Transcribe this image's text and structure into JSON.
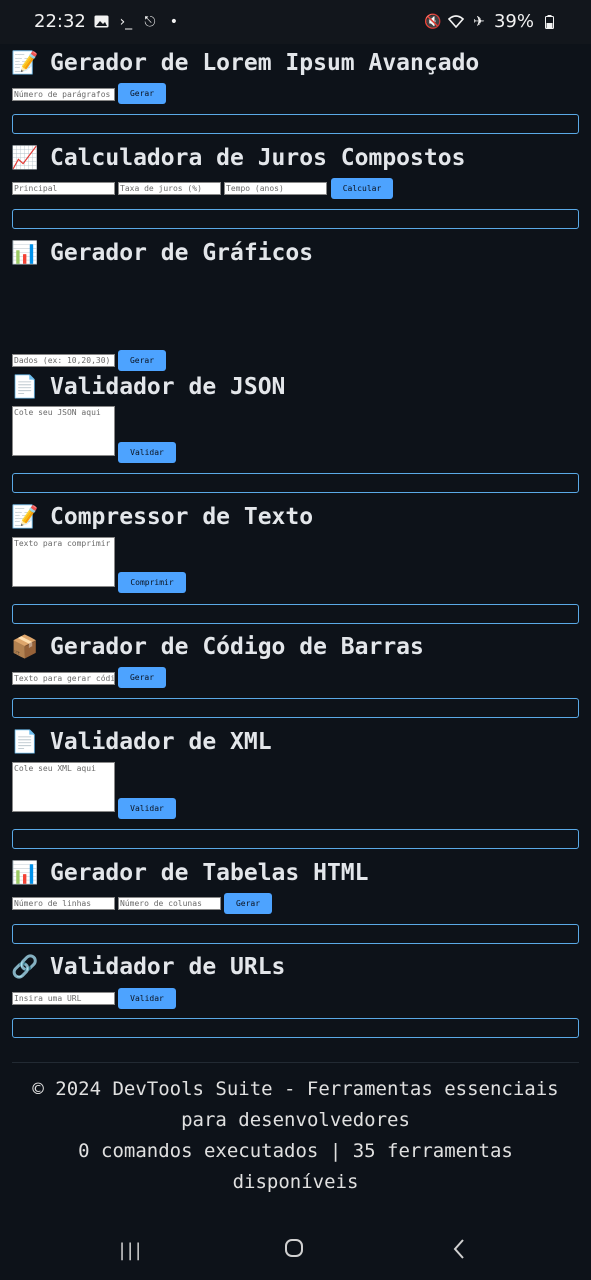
{
  "statusbar": {
    "time": "22:32",
    "battery": "39%",
    "icons_left": [
      "image-icon",
      "terminal-icon",
      "share-icon",
      "dot-icon"
    ],
    "icons_right": [
      "mute-icon",
      "wifi-icon",
      "airplane-icon",
      "battery-icon"
    ]
  },
  "sections": {
    "lorem": {
      "emoji": "📝",
      "title": "Gerador de Lorem Ipsum Avançado",
      "input_placeholder": "Número de parágrafos",
      "button": "Gerar"
    },
    "juros": {
      "emoji": "📈",
      "title": "Calculadora de Juros Compostos",
      "principal_placeholder": "Principal",
      "taxa_placeholder": "Taxa de juros (%)",
      "tempo_placeholder": "Tempo (anos)",
      "button": "Calcular"
    },
    "graficos": {
      "emoji": "📊",
      "title": "Gerador de Gráficos",
      "input_placeholder": "Dados (ex: 10,20,30)",
      "button": "Gerar"
    },
    "json": {
      "emoji": "📄",
      "title": "Validador de JSON",
      "textarea_placeholder": "Cole seu JSON aqui",
      "button": "Validar"
    },
    "compressor": {
      "emoji": "📝",
      "title": "Compressor de Texto",
      "textarea_placeholder": "Texto para comprimir",
      "button": "Comprimir"
    },
    "barras": {
      "emoji": "📦",
      "title": "Gerador de Código de Barras",
      "input_placeholder": "Texto para gerar código",
      "button": "Gerar"
    },
    "xml": {
      "emoji": "📄",
      "title": "Validador de XML",
      "textarea_placeholder": "Cole seu XML aqui",
      "button": "Validar"
    },
    "tabelas": {
      "emoji": "📊",
      "title": "Gerador de Tabelas HTML",
      "linhas_placeholder": "Número de linhas",
      "colunas_placeholder": "Número de colunas",
      "button": "Gerar"
    },
    "urls": {
      "emoji": "🔗",
      "title": "Validador de URLs",
      "input_placeholder": "Insira uma URL",
      "button": "Validar"
    }
  },
  "footer": {
    "line1": "© 2024 DevTools Suite - Ferramentas essenciais para desenvolvedores",
    "line2": "0 comandos executados | 35 ferramentas disponíveis"
  },
  "navbar": {
    "recent_icon": "|||",
    "home_icon": "○",
    "back_icon": "‹"
  },
  "colors": {
    "background": "#0d1219",
    "accent": "#4da3ff",
    "result_border": "#5aa9e6"
  }
}
